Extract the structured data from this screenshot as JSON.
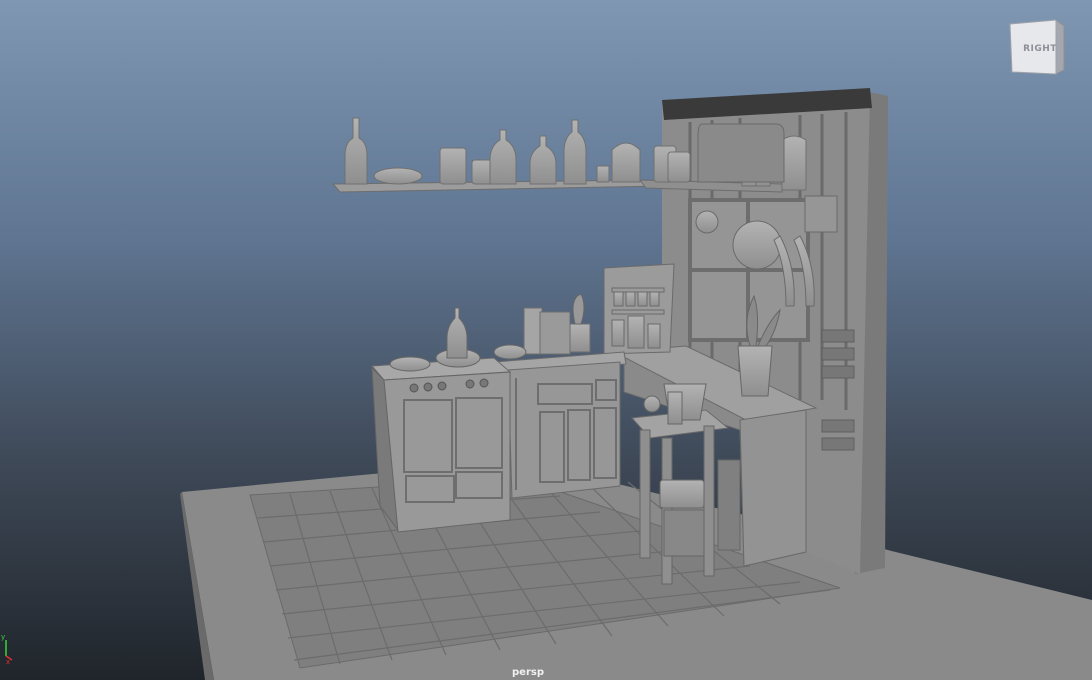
{
  "viewport": {
    "camera_label": "persp",
    "background_top": "#7f97b3",
    "background_bottom": "#20252b"
  },
  "viewcube": {
    "face_label": "RIGHT"
  },
  "axis_gizmo": {
    "y_label": "y",
    "x_label": "x",
    "y_color": "#35d735",
    "x_color": "#e03030"
  },
  "scene": {
    "model_color": "#9a9a9a",
    "floor_color": "#868686"
  }
}
